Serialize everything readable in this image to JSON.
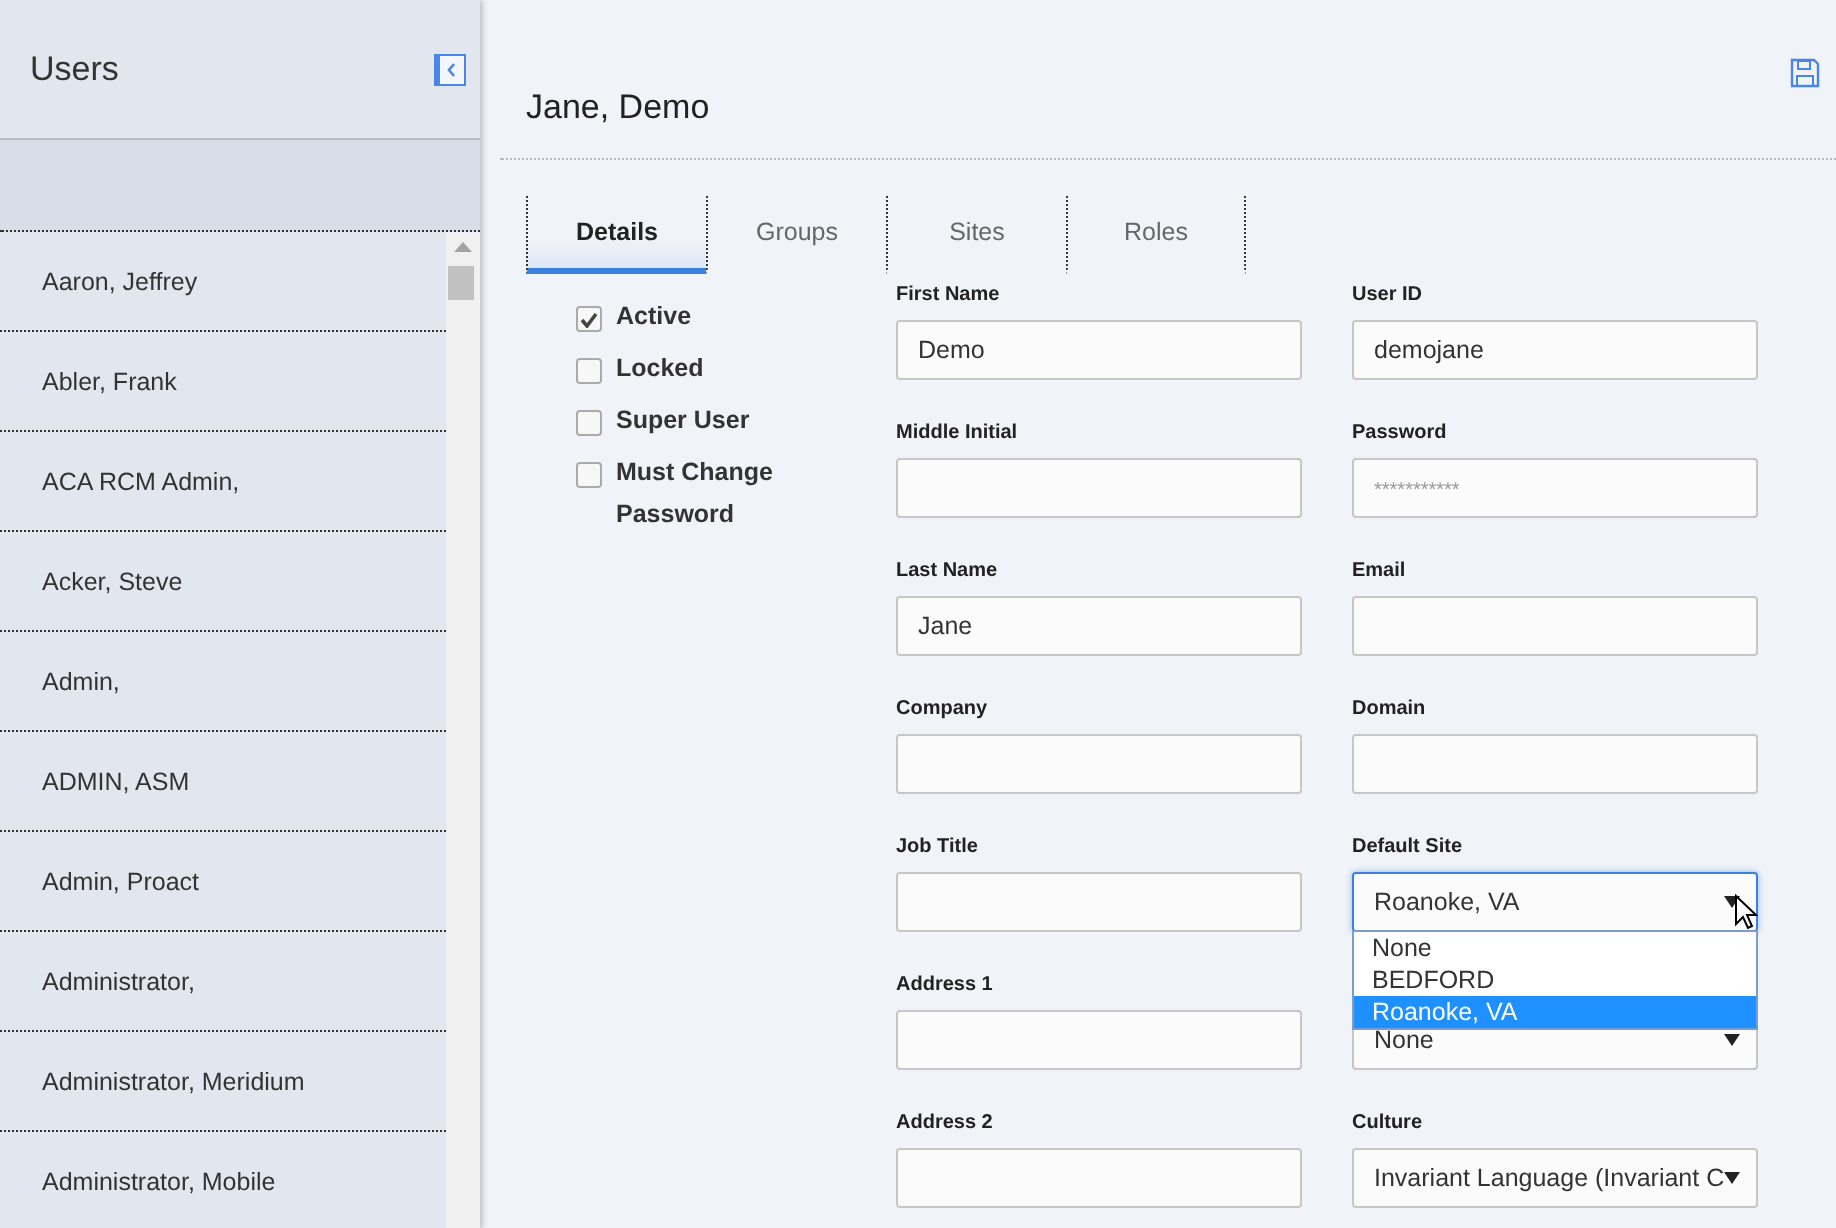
{
  "sidebar": {
    "title": "Users",
    "users": [
      "Aaron, Jeffrey",
      "Abler, Frank",
      "ACA RCM Admin,",
      "Acker, Steve",
      "Admin,",
      "ADMIN, ASM",
      "Admin, Proact",
      "Administrator,",
      "Administrator, Meridium",
      "Administrator, Mobile"
    ]
  },
  "main": {
    "title": "Jane, Demo",
    "tabs": [
      {
        "label": "Details",
        "selected": true
      },
      {
        "label": "Groups",
        "selected": false
      },
      {
        "label": "Sites",
        "selected": false
      },
      {
        "label": "Roles",
        "selected": false
      }
    ],
    "flags": [
      {
        "label": "Active",
        "checked": true
      },
      {
        "label": "Locked",
        "checked": false
      },
      {
        "label": "Super User",
        "checked": false
      },
      {
        "label": "Must Change Password",
        "checked": false
      }
    ],
    "fields": [
      {
        "kind": "text",
        "label": "First Name",
        "value": "Demo"
      },
      {
        "kind": "text",
        "label": "User ID",
        "value": "demojane"
      },
      {
        "kind": "text",
        "label": "Middle Initial"
      },
      {
        "kind": "password",
        "label": "Password",
        "placeholder": "***********"
      },
      {
        "kind": "text",
        "label": "Last Name",
        "value": "Jane"
      },
      {
        "kind": "text",
        "label": "Email"
      },
      {
        "kind": "text",
        "label": "Company"
      },
      {
        "kind": "text",
        "label": "Domain"
      },
      {
        "kind": "text",
        "label": "Job Title"
      },
      {
        "kind": "select",
        "label": "Default Site",
        "value": "Roanoke, VA",
        "expanded": true,
        "options": [
          {
            "label": "None",
            "selected": false
          },
          {
            "label": "BEDFORD",
            "selected": false
          },
          {
            "label": "Roanoke, VA",
            "selected": true
          }
        ]
      },
      {
        "kind": "text",
        "label": "Address 1"
      },
      {
        "kind": "select",
        "value": "None",
        "expanded": false
      },
      {
        "kind": "text",
        "label": "Address 2"
      },
      {
        "kind": "select",
        "label": "Culture",
        "value": "Invariant Language (Invariant C",
        "expanded": false
      }
    ]
  }
}
